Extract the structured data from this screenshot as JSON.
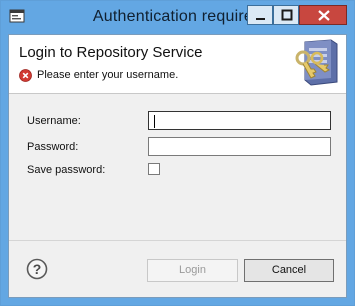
{
  "window": {
    "title": "Authentication required"
  },
  "header": {
    "title": "Login to Repository Service",
    "message": "Please enter your username.",
    "message_icon": "error-icon",
    "banner_icon": "keys-server-icon"
  },
  "form": {
    "username_label": "Username:",
    "username_value": "",
    "password_label": "Password:",
    "password_value": "",
    "save_password_label": "Save password:",
    "save_password_checked": false
  },
  "buttons": {
    "help_icon": "help-icon",
    "login_label": "Login",
    "login_enabled": false,
    "cancel_label": "Cancel"
  },
  "colors": {
    "titlebar": "#63a7e3",
    "close": "#c8473f",
    "dialog_bg": "#f0f0f0",
    "error": "#d13a32"
  }
}
